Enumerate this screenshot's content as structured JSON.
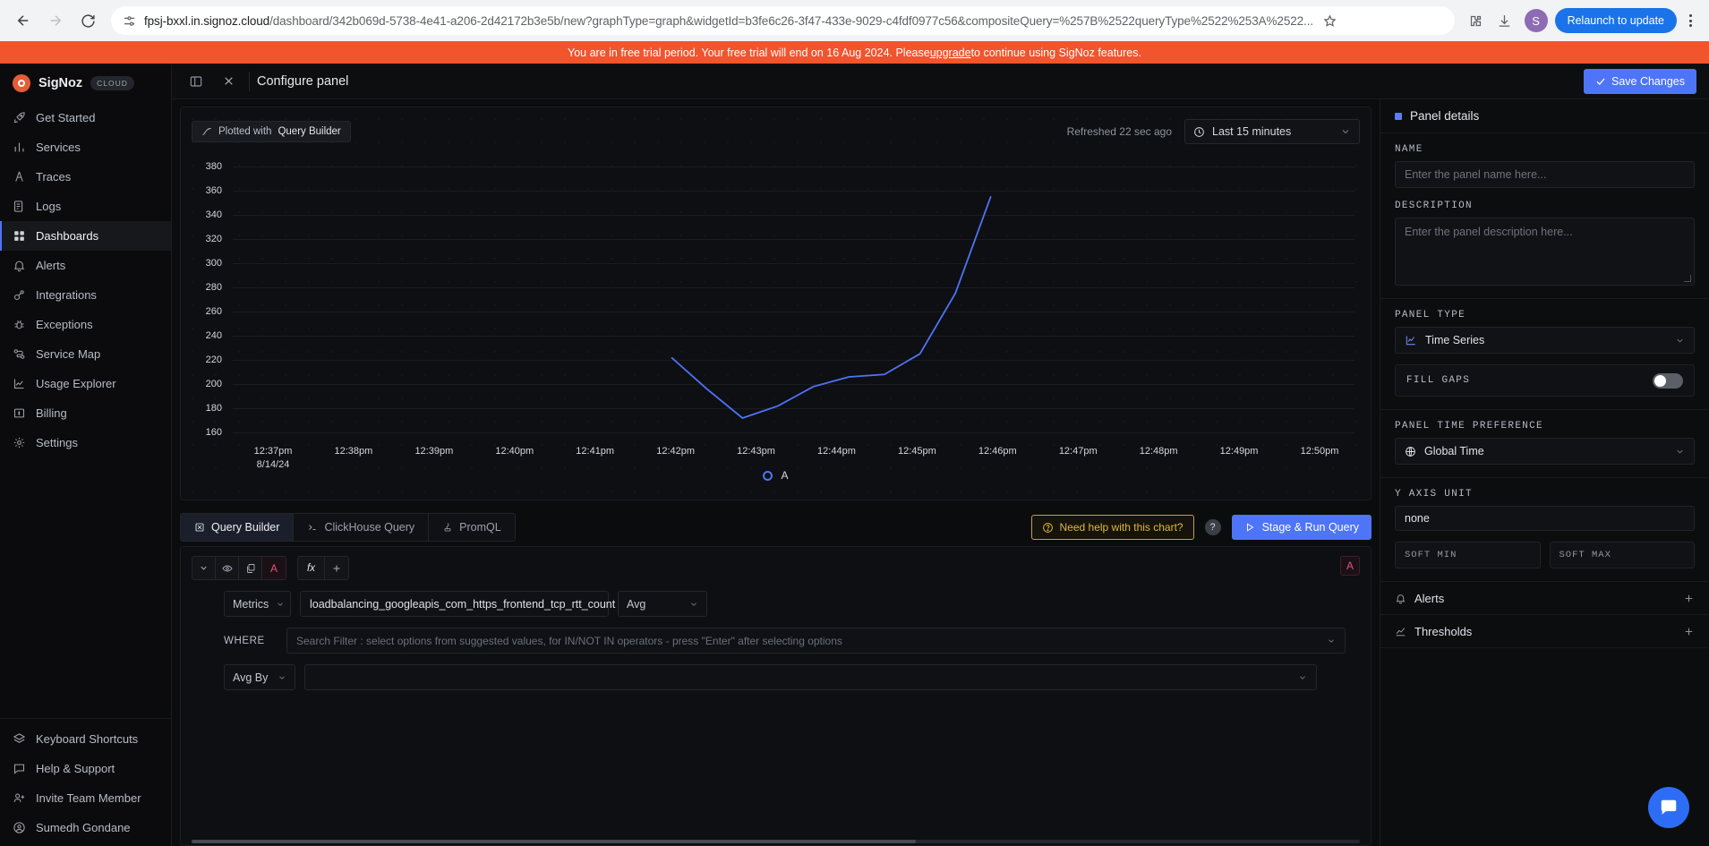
{
  "browser": {
    "url_domain": "fpsj-bxxl.in.signoz.cloud",
    "url_path": "/dashboard/342b069d-5738-4e41-a206-2d42172b3e5b/new?graphType=graph&widgetId=b3fe6c26-3f47-433e-9029-c4fdf0977c56&compositeQuery=%257B%2522queryType%2522%253A%2522...",
    "relaunch_label": "Relaunch to update",
    "profile_initial": "S"
  },
  "trial_banner": {
    "text_before": "You are in free trial period. Your free trial will end on 16 Aug 2024. Please ",
    "link": "upgrade",
    "text_after": " to continue using SigNoz features."
  },
  "sidebar": {
    "brand": "SigNoz",
    "tag": "CLOUD",
    "items": [
      {
        "label": "Get Started",
        "icon": "rocket-icon",
        "active": false
      },
      {
        "label": "Services",
        "icon": "bar-chart-icon",
        "active": false
      },
      {
        "label": "Traces",
        "icon": "traces-icon",
        "active": false
      },
      {
        "label": "Logs",
        "icon": "logs-icon",
        "active": false
      },
      {
        "label": "Dashboards",
        "icon": "grid-icon",
        "active": true
      },
      {
        "label": "Alerts",
        "icon": "bell-icon",
        "active": false
      },
      {
        "label": "Integrations",
        "icon": "integrations-icon",
        "active": false
      },
      {
        "label": "Exceptions",
        "icon": "bug-icon",
        "active": false
      },
      {
        "label": "Service Map",
        "icon": "service-map-icon",
        "active": false
      },
      {
        "label": "Usage Explorer",
        "icon": "usage-icon",
        "active": false
      },
      {
        "label": "Billing",
        "icon": "billing-icon",
        "active": false
      },
      {
        "label": "Settings",
        "icon": "gear-icon",
        "active": false
      }
    ],
    "footer_items": [
      {
        "label": "Keyboard Shortcuts",
        "icon": "layers-icon"
      },
      {
        "label": "Help & Support",
        "icon": "chat-icon"
      },
      {
        "label": "Invite Team Member",
        "icon": "user-plus-icon"
      },
      {
        "label": "Sumedh Gondane",
        "icon": "user-circle-icon"
      }
    ]
  },
  "panel_header": {
    "title": "Configure panel",
    "save_label": "Save Changes"
  },
  "chart_toolbar": {
    "plotted_prefix": "Plotted with",
    "plotted_source": "Query Builder",
    "refreshed": "Refreshed 22 sec ago",
    "time_range": "Last 15 minutes"
  },
  "chart_data": {
    "type": "line",
    "title": "",
    "xlabel": "",
    "ylabel": "",
    "date_label": "8/14/24",
    "legend": [
      "A"
    ],
    "legend_color": "#4e74f8",
    "grid": true,
    "ylim": [
      155,
      390
    ],
    "yticks": [
      380,
      360,
      340,
      320,
      300,
      280,
      260,
      240,
      220,
      200,
      180,
      160
    ],
    "xticks": [
      "12:37pm",
      "12:38pm",
      "12:39pm",
      "12:40pm",
      "12:41pm",
      "12:42pm",
      "12:43pm",
      "12:44pm",
      "12:45pm",
      "12:46pm",
      "12:47pm",
      "12:48pm",
      "12:49pm",
      "12:50pm"
    ],
    "series": [
      {
        "name": "A",
        "color": "#4e74f8",
        "x": [
          "12:42pm",
          "12:42:30pm",
          "12:43pm",
          "12:43:30pm",
          "12:44pm",
          "12:44:30pm",
          "12:45pm",
          "12:45:20pm",
          "12:45:40pm",
          "12:46pm"
        ],
        "values": [
          222,
          196,
          172,
          182,
          198,
          206,
          208,
          225,
          275,
          355
        ]
      }
    ]
  },
  "query_section": {
    "tabs": [
      {
        "label": "Query Builder",
        "icon": "query-builder-icon",
        "active": true
      },
      {
        "label": "ClickHouse Query",
        "icon": "terminal-icon",
        "active": false
      },
      {
        "label": "PromQL",
        "icon": "promql-icon",
        "active": false
      }
    ],
    "help_label": "Need help with this chart?",
    "run_label": "Stage & Run Query",
    "query_letter": "A",
    "toolbar_icons": [
      "chevron-down-icon",
      "eye-icon",
      "copy-icon",
      "letter-a-icon",
      "function-icon",
      "plus-icon"
    ],
    "data_source": "Metrics",
    "metric_name": "loadbalancing_googleapis_com_https_frontend_tcp_rtt_count",
    "aggregation": "Avg",
    "where_label": "WHERE",
    "where_placeholder": "Search Filter : select options from suggested values, for IN/NOT IN operators - press \"Enter\" after selecting options",
    "group_by_label": "Avg By",
    "group_by_value": ""
  },
  "right_panel": {
    "title": "Panel details",
    "name_label": "NAME",
    "name_placeholder": "Enter the panel name here...",
    "description_label": "DESCRIPTION",
    "description_placeholder": "Enter the panel description here...",
    "panel_type_label": "PANEL TYPE",
    "panel_type_value": "Time Series",
    "fill_gaps_label": "FILL GAPS",
    "fill_gaps_on": false,
    "time_pref_label": "PANEL TIME PREFERENCE",
    "time_pref_value": "Global Time",
    "y_axis_label": "Y AXIS UNIT",
    "y_axis_value": "none",
    "soft_min_label": "SOFT MIN",
    "soft_max_label": "SOFT MAX",
    "soft_min_value": "",
    "soft_max_value": "",
    "alerts_label": "Alerts",
    "thresholds_label": "Thresholds"
  }
}
